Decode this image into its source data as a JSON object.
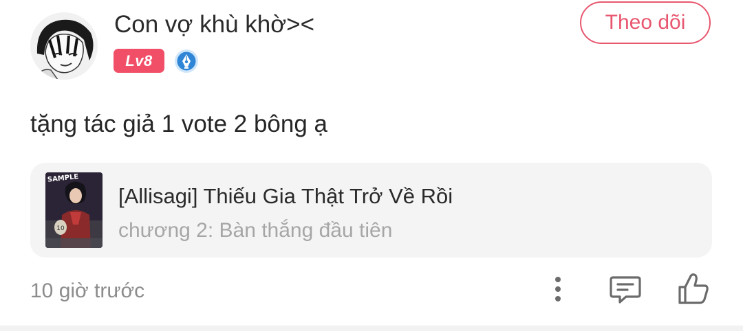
{
  "user": {
    "name": "Con vợ khù khờ><",
    "level": "Lv8",
    "follow_label": "Theo dõi"
  },
  "comment": {
    "text": "tặng tác giả 1 vote 2 bông ạ",
    "time": "10 giờ trước"
  },
  "chapter_card": {
    "series_title": "[Allisagi] Thiếu Gia Thật Trở Về Rồi",
    "chapter": "chương 2: Bàn thắng đầu tiên",
    "cover_watermark": "SAMPLE"
  },
  "actions": {
    "more_icon": "more-vertical-icon",
    "reply_icon": "comment-icon",
    "like_icon": "thumbs-up-icon"
  },
  "colors": {
    "accent": "#f04f67",
    "follow_border": "#e8576f",
    "badge_blue": "#2f86d6",
    "card_bg": "#f4f4f4"
  }
}
